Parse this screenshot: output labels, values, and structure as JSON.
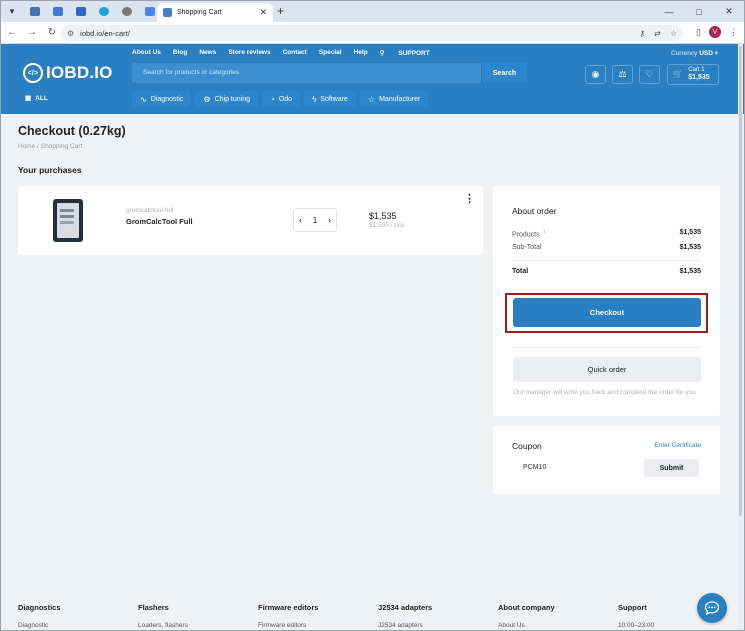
{
  "browser": {
    "tab_title": "Shopping Cart",
    "url": "iobd.io/en-cart/",
    "profile_initial": "V",
    "window_minimize": "—",
    "window_maximize": "□",
    "window_close": "✕"
  },
  "header": {
    "logo_text": "IOBD.IO",
    "logo_mark": "</>",
    "top_links": [
      "About Us",
      "Blog",
      "News",
      "Store reviews",
      "Contact",
      "Special",
      "Help",
      "SUPPORT"
    ],
    "currency_label": "Currency",
    "currency_value": "USD",
    "search_placeholder": "Search for products or categories",
    "search_button": "Search",
    "cart_label": "Cart 1",
    "cart_total": "$1,535",
    "all_label": "ALL",
    "categories": [
      "Diagnostic",
      "Chip tuning",
      "Odo",
      "Software",
      "Manufacturer"
    ]
  },
  "page": {
    "title": "Checkout (0.27kg)",
    "breadcrumb": "Home  /  Shopping Cart",
    "purchases_heading": "Your purchases"
  },
  "product": {
    "sku": "gromcalctool-full",
    "name": "GromCalcTool Full",
    "qty": "1",
    "price": "$1,535",
    "unit_price": "$1,535 / pcs"
  },
  "order": {
    "heading": "About order",
    "products_label": "Products",
    "products_count": "1",
    "products_value": "$1,535",
    "subtotal_label": "Sub-Total",
    "subtotal_value": "$1,535",
    "total_label": "Total",
    "total_value": "$1,535",
    "checkout_button": "Checkout",
    "quick_order_button": "Quick order",
    "note": "Our manager will write you back and complete the order for you"
  },
  "coupon": {
    "heading": "Coupon",
    "certificate_link": "Enter Certificate",
    "code": "PCM10",
    "submit": "Submit"
  },
  "footer": {
    "columns": [
      {
        "heading": "Diagnostics",
        "item": "Diagnostic"
      },
      {
        "heading": "Flashers",
        "item": "Loaders, flashers"
      },
      {
        "heading": "Firmware editors",
        "item": "Firmware editors"
      },
      {
        "heading": "J2534 adapters",
        "item": "J2534 adapters"
      },
      {
        "heading": "About company",
        "item": "About Us"
      },
      {
        "heading": "Support",
        "item": "10:00–23:00"
      }
    ]
  },
  "colors": {
    "brand": "#2a7fc3",
    "highlight": "#9a1c20"
  }
}
